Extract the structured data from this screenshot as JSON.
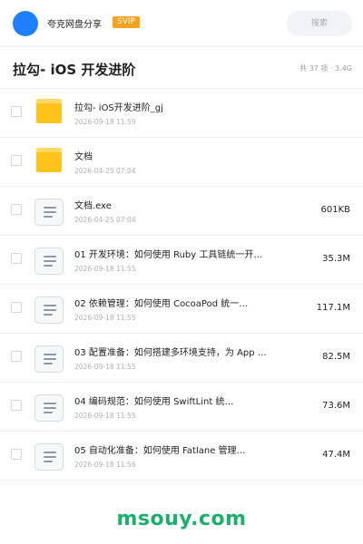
{
  "topbar": {
    "share_name": "夸克网盘分享",
    "badge": "SVIP",
    "search_placeholder": "搜索"
  },
  "header": {
    "title": "拉勾- iOS 开发进阶",
    "summary": "共 37 项 · 3.4G"
  },
  "items": [
    {
      "type": "folder",
      "icon": "folder-icon",
      "name": "拉勾- iOS开发进阶_gj",
      "date": "2026-09-18 11:59",
      "size": ""
    },
    {
      "type": "folder",
      "icon": "folder-icon",
      "name": "文档",
      "date": "2026-04-25 07:04",
      "size": ""
    },
    {
      "type": "file",
      "icon": "document-icon",
      "name": "文档.exe",
      "date": "2026-04-25 07:04",
      "size": "601KB"
    },
    {
      "type": "file",
      "icon": "document-icon",
      "name": "01  开发环境：如何使用 Ruby 工具链统一开…",
      "date": "2026-09-18 11:55",
      "size": "35.3M"
    },
    {
      "type": "file",
      "icon": "document-icon",
      "name": "02  依赖管理：如何使用 CocoaPod 统一…",
      "date": "2026-09-18 11:55",
      "size": "117.1M"
    },
    {
      "type": "file",
      "icon": "document-icon",
      "name": "03  配置准备：如何搭建多环境支持，为 App …",
      "date": "2026-09-18 11:55",
      "size": "82.5M"
    },
    {
      "type": "file",
      "icon": "document-icon",
      "name": "04  编码规范：如何使用 SwiftLint 统…",
      "date": "2026-09-18 11:55",
      "size": "73.6M"
    },
    {
      "type": "file",
      "icon": "document-icon",
      "name": "05  自动化准备：如何使用 Fatlane 管理…",
      "date": "2026-09-18 11:56",
      "size": "47.4M"
    }
  ],
  "watermark": "msouy.com",
  "colors": {
    "accent": "#1e80ff",
    "badge": "#f7a21c",
    "folder": "#ffc41c",
    "watermark": "#19b06b"
  }
}
